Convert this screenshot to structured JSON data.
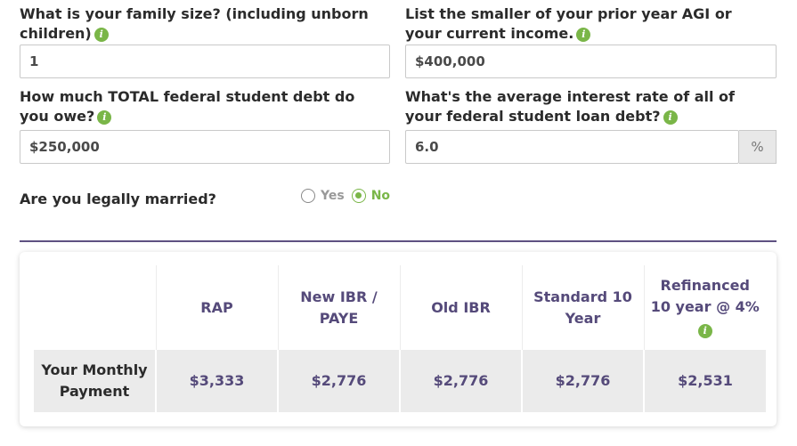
{
  "questions": {
    "family_size": {
      "label": "What is your family size? (including unborn children)",
      "value": "1"
    },
    "agi": {
      "label": "List the smaller of your prior year AGI or your current income.",
      "value": "$400,000"
    },
    "total_debt": {
      "label": "How much TOTAL federal student debt do you owe?",
      "value": "$250,000"
    },
    "interest_rate": {
      "label": "What's the average interest rate of all of your federal student loan debt?",
      "value": "6.0",
      "suffix": "%"
    },
    "married": {
      "label": "Are you legally married?",
      "options": [
        "Yes",
        "No"
      ],
      "selected": "No"
    }
  },
  "info_icon_glyph": "i",
  "accent_color": "#7ab648",
  "table_header_color": "#554a7a",
  "results": {
    "columns": [
      "RAP",
      "New IBR / PAYE",
      "Old IBR",
      "Standard 10 Year",
      "Refinanced 10 year @ 4%"
    ],
    "row_label": "Your Monthly Payment",
    "payments": [
      "$3,333",
      "$2,776",
      "$2,776",
      "$2,776",
      "$2,531"
    ]
  }
}
